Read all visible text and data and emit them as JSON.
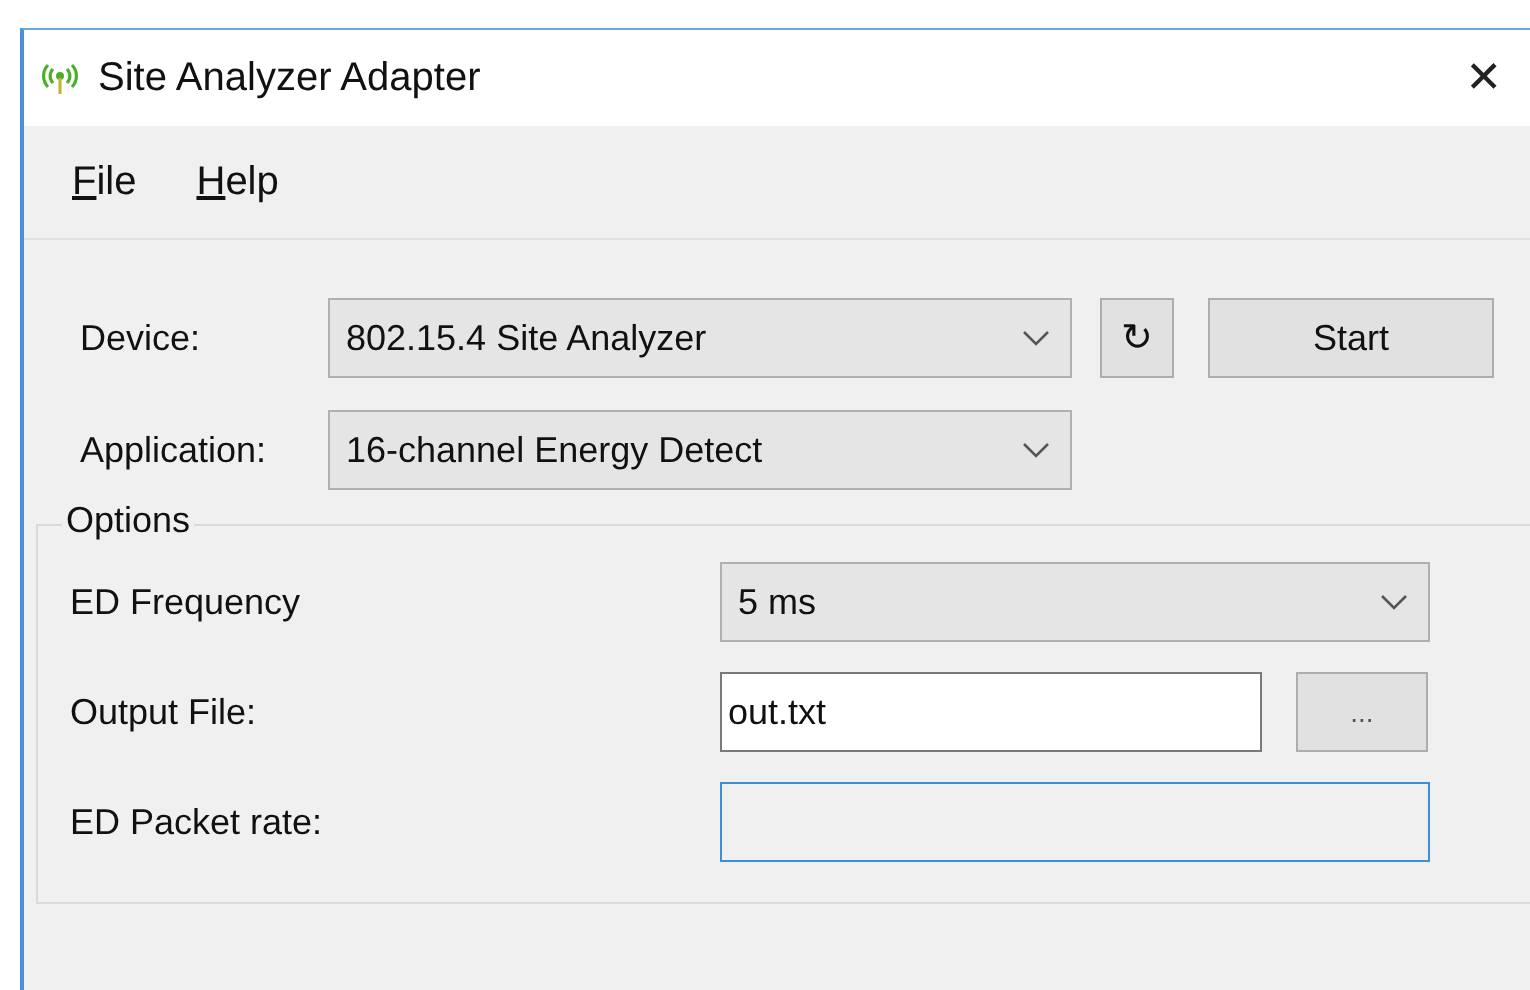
{
  "window": {
    "title": "Site Analyzer Adapter",
    "close": "✕"
  },
  "menu": [
    {
      "label": "File"
    },
    {
      "label": "Help"
    }
  ],
  "device": {
    "label": "Device:",
    "value": "802.15.4 Site Analyzer"
  },
  "refresh": "↻",
  "start": "Start",
  "application": {
    "label": "Application:",
    "value": "16-channel Energy Detect"
  },
  "options": {
    "title": "Options",
    "rows": [
      {
        "kind": "select",
        "label": "ED Frequency",
        "value": "5 ms"
      },
      {
        "kind": "text",
        "label": "Output File:",
        "value": "out.txt",
        "browse": "...",
        "focused": false
      },
      {
        "kind": "text",
        "label": "ED Packet rate:",
        "focused": true
      }
    ]
  }
}
